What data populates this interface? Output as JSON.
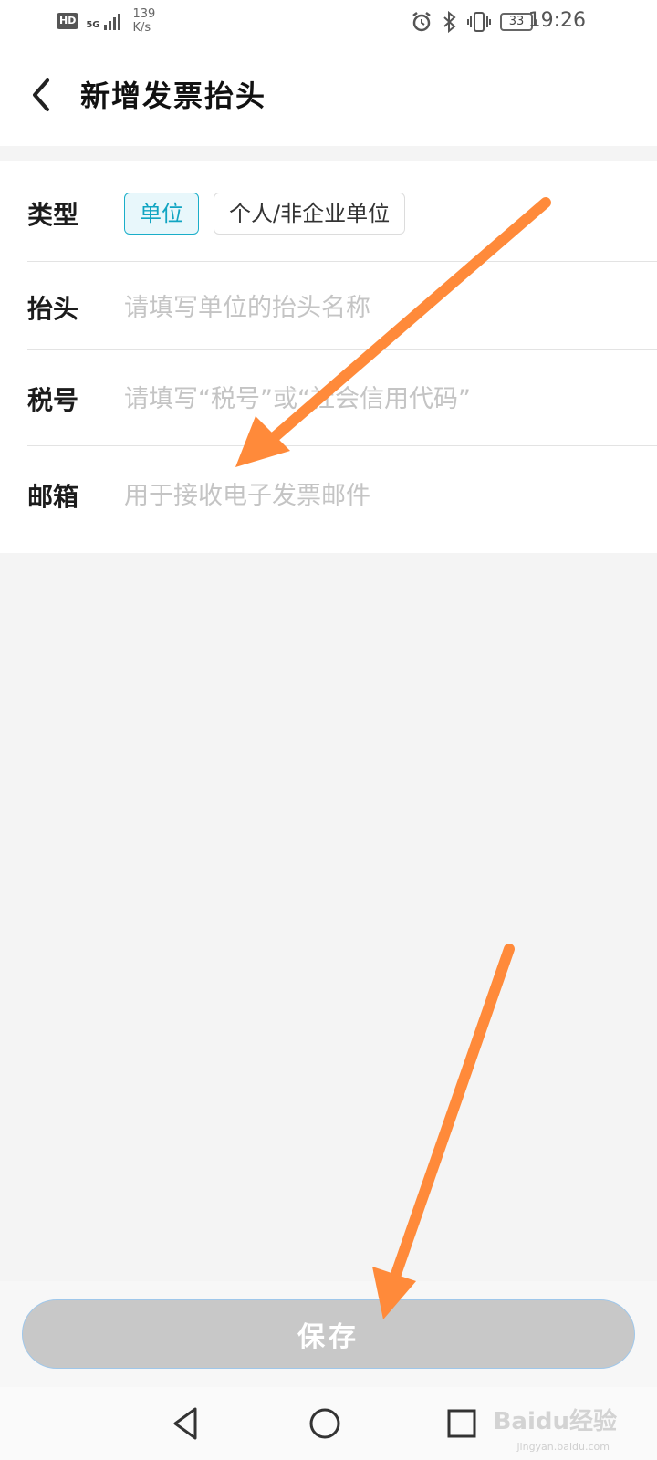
{
  "status_bar": {
    "hd": "HD",
    "network": "5G",
    "speed_value": "139",
    "speed_unit": "K/s",
    "battery": "33",
    "time": "19:26",
    "icons": [
      "alarm-icon",
      "bluetooth-icon",
      "vibrate-icon"
    ]
  },
  "header": {
    "title": "新增发票抬头"
  },
  "form": {
    "type": {
      "label": "类型",
      "options": [
        "单位",
        "个人/非企业单位"
      ],
      "selected": "单位"
    },
    "title_field": {
      "label": "抬头",
      "placeholder": "请填写单位的抬头名称"
    },
    "tax_field": {
      "label": "税号",
      "placeholder": "请填写“税号”或“社会信用代码”"
    },
    "email_field": {
      "label": "邮箱",
      "placeholder": "用于接收电子发票邮件"
    }
  },
  "actions": {
    "save_label": "保存"
  },
  "watermark": {
    "brand": "Baidu经验",
    "sub": "jingyan.baidu.com"
  },
  "colors": {
    "accent": "#11a5c2",
    "save_disabled": "#c8c8c8",
    "annotation_arrow": "#ff8a3a"
  }
}
